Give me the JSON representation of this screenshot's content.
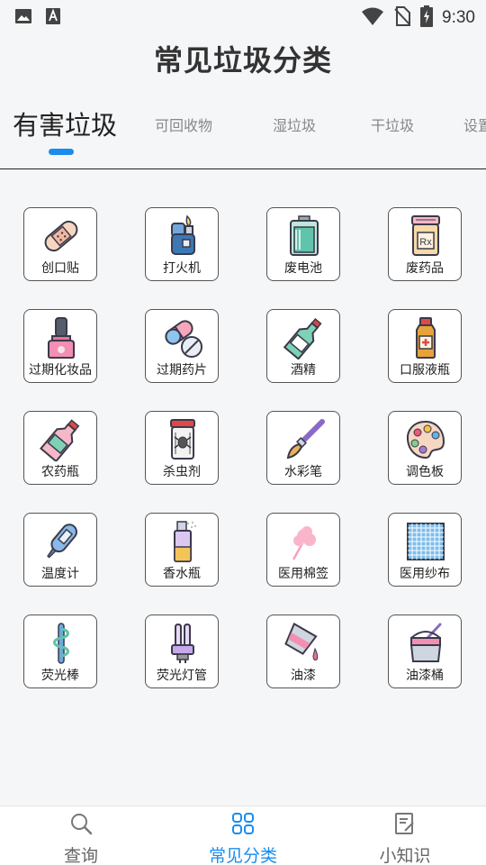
{
  "status_bar": {
    "time": "9:30"
  },
  "page_title": "常见垃圾分类",
  "tabs": [
    {
      "label": "有害垃圾",
      "active": true
    },
    {
      "label": "可回收物",
      "active": false
    },
    {
      "label": "湿垃圾",
      "active": false
    },
    {
      "label": "干垃圾",
      "active": false
    },
    {
      "label": "设置",
      "active": false
    }
  ],
  "items": [
    {
      "label": "创口贴",
      "icon": "bandage-icon"
    },
    {
      "label": "打火机",
      "icon": "lighter-icon"
    },
    {
      "label": "废电池",
      "icon": "battery-icon"
    },
    {
      "label": "废药品",
      "icon": "medicine-jar-icon"
    },
    {
      "label": "过期化妆品",
      "icon": "nail-polish-icon"
    },
    {
      "label": "过期药片",
      "icon": "pills-icon"
    },
    {
      "label": "酒精",
      "icon": "alcohol-bottle-icon"
    },
    {
      "label": "口服液瓶",
      "icon": "oral-liquid-bottle-icon"
    },
    {
      "label": "农药瓶",
      "icon": "pesticide-bottle-icon"
    },
    {
      "label": "杀虫剂",
      "icon": "insecticide-can-icon"
    },
    {
      "label": "水彩笔",
      "icon": "paintbrush-icon"
    },
    {
      "label": "调色板",
      "icon": "palette-icon"
    },
    {
      "label": "温度计",
      "icon": "thermometer-icon"
    },
    {
      "label": "香水瓶",
      "icon": "perfume-spray-icon"
    },
    {
      "label": "医用棉签",
      "icon": "cotton-swab-icon"
    },
    {
      "label": "医用纱布",
      "icon": "gauze-icon"
    },
    {
      "label": "荧光棒",
      "icon": "glow-stick-icon"
    },
    {
      "label": "荧光灯管",
      "icon": "fluorescent-tube-icon"
    },
    {
      "label": "油漆",
      "icon": "paint-pour-icon"
    },
    {
      "label": "油漆桶",
      "icon": "paint-bucket-icon"
    }
  ],
  "bottom_nav": [
    {
      "label": "查询",
      "icon": "search-icon",
      "active": false
    },
    {
      "label": "常见分类",
      "icon": "grid-icon",
      "active": true
    },
    {
      "label": "小知识",
      "icon": "notes-icon",
      "active": false
    }
  ],
  "colors": {
    "accent": "#1a8cef",
    "icon_pink": "#f7b5c8",
    "icon_teal": "#7fd1c2",
    "icon_outline": "#3a3a4a"
  }
}
